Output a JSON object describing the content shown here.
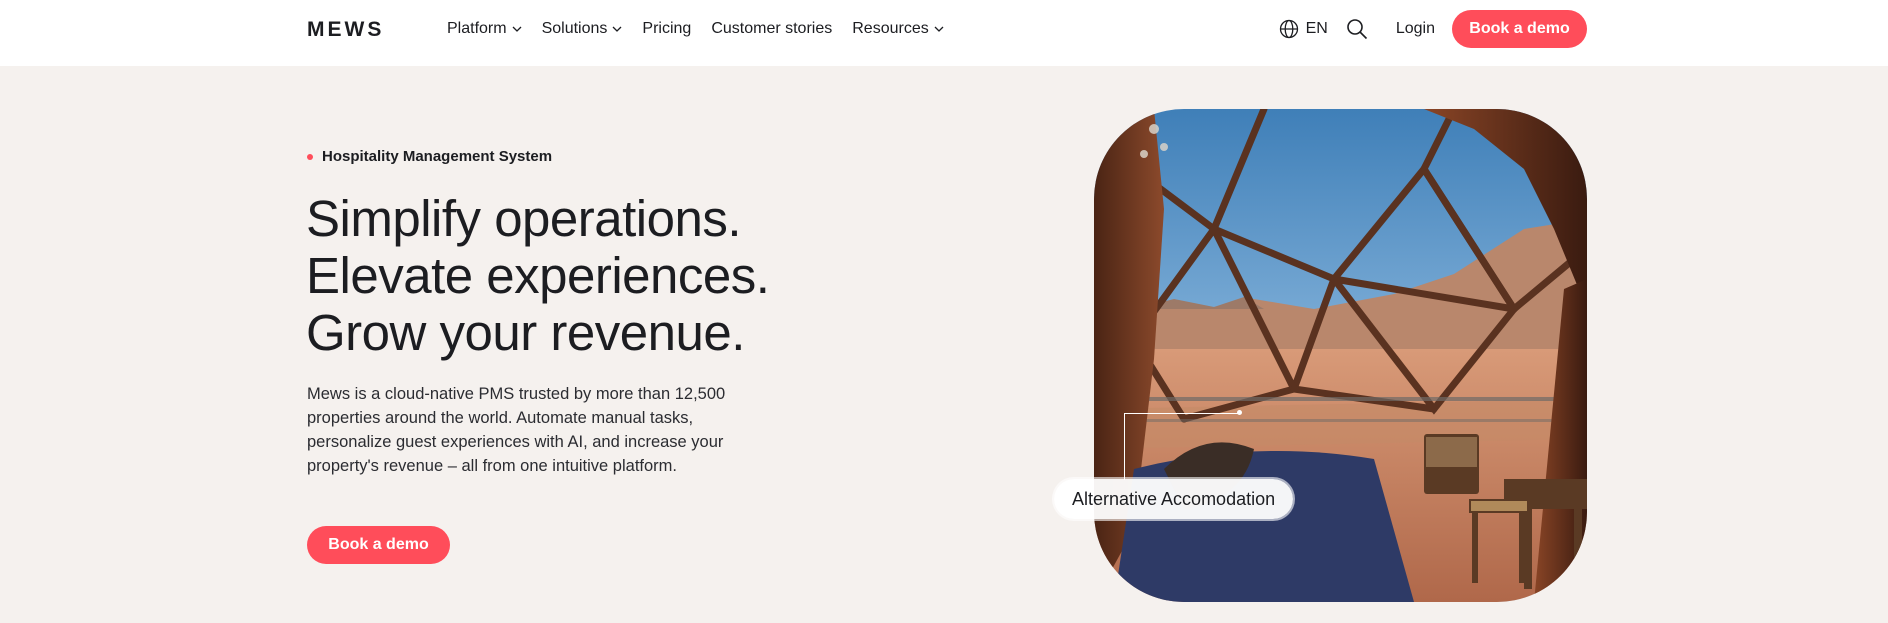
{
  "brand": {
    "logo": "MEWS",
    "accent": "#ff4d5a"
  },
  "nav": {
    "items": [
      {
        "label": "Platform",
        "has_dropdown": true
      },
      {
        "label": "Solutions",
        "has_dropdown": true
      },
      {
        "label": "Pricing",
        "has_dropdown": false
      },
      {
        "label": "Customer stories",
        "has_dropdown": false
      },
      {
        "label": "Resources",
        "has_dropdown": true
      }
    ],
    "language": "EN",
    "login": "Login",
    "cta": "Book a demo"
  },
  "hero": {
    "eyebrow": "Hospitality Management System",
    "headline": [
      "Simplify operations.",
      "Elevate experiences.",
      "Grow your revenue."
    ],
    "description": "Mews is a cloud-native PMS trusted by more than 12,500 properties around the world. Automate manual tasks, personalize guest experiences with AI, and increase your property's revenue – all from one intuitive platform.",
    "cta": "Book a demo",
    "image_tag": "Alternative Accomodation"
  }
}
